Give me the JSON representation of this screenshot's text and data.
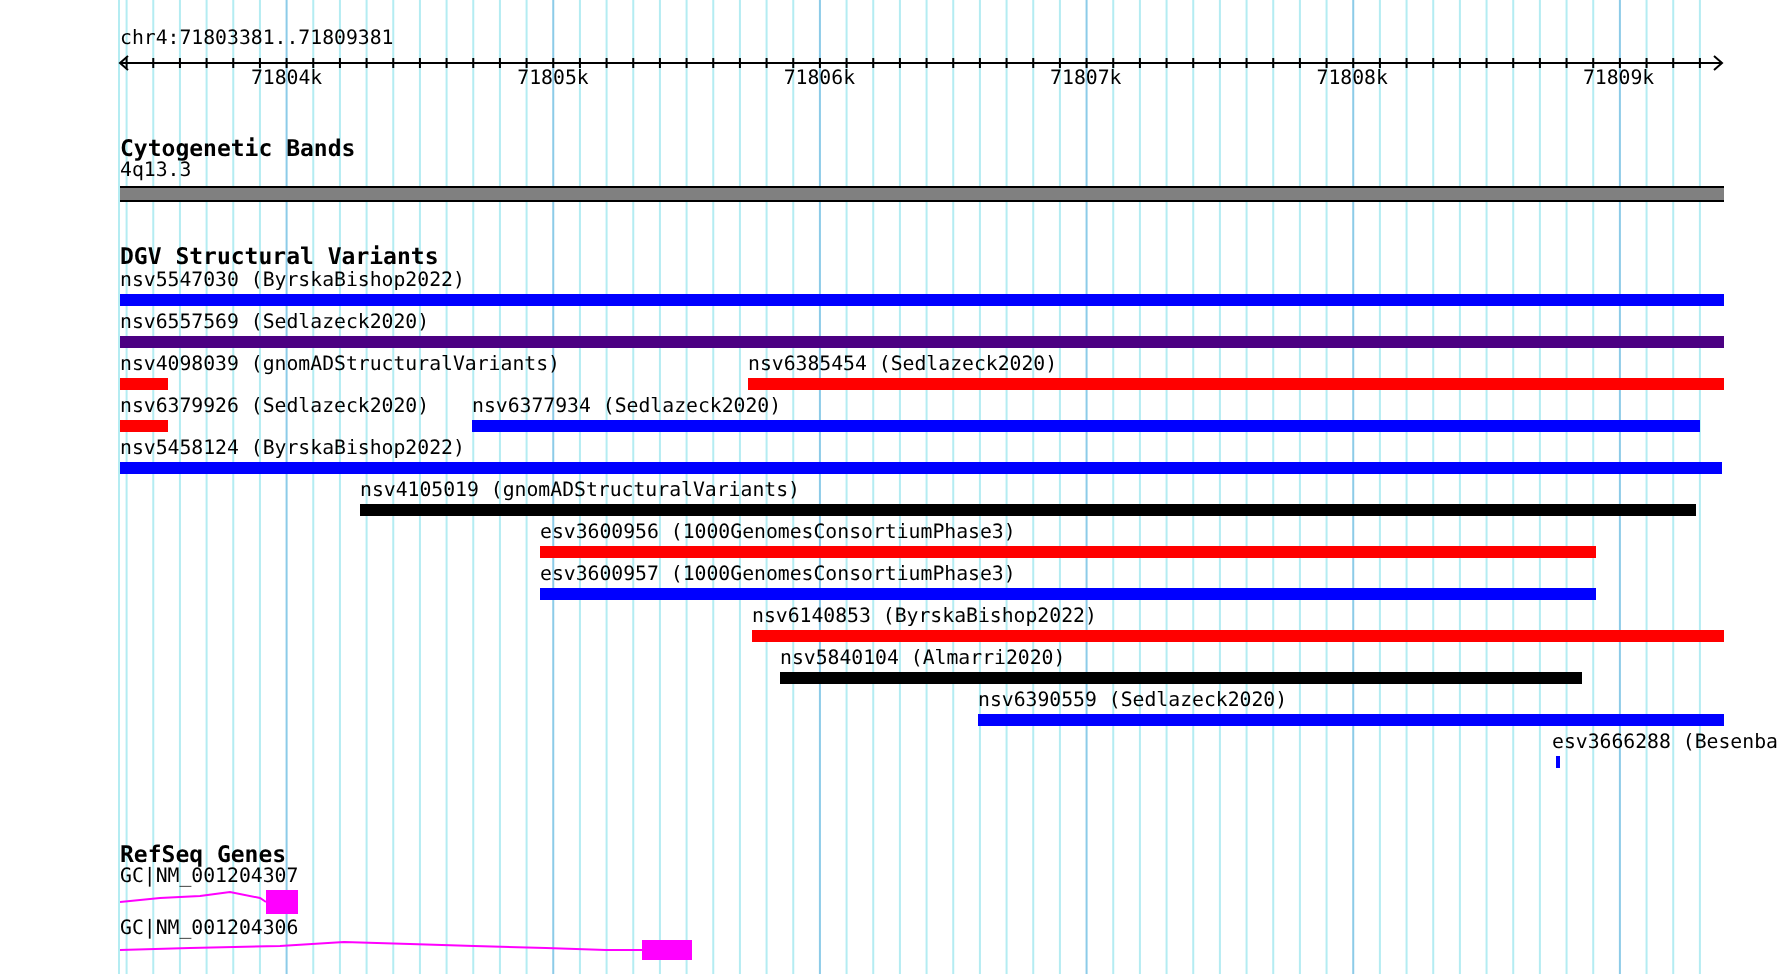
{
  "location": "chr4:71803381..71809381",
  "ruler": {
    "ticks": [
      "71804k",
      "71805k",
      "71806k",
      "71807k",
      "71808k",
      "71809k"
    ]
  },
  "tracks": [
    {
      "kind": "bands",
      "title": "Cytogenetic Bands",
      "features": [
        {
          "label": "4q13.3"
        }
      ]
    },
    {
      "kind": "variants",
      "title": "DGV Structural Variants",
      "rows": [
        [
          {
            "label": "nsv5547030 (ByrskaBishop2022)",
            "color": "#0000ff"
          }
        ],
        [
          {
            "label": "nsv6557569 (Sedlazeck2020)",
            "color": "#4b0082"
          }
        ],
        [
          {
            "label": "nsv4098039 (gnomADStructuralVariants)",
            "color": "#ff0000"
          },
          {
            "label": "nsv6385454 (Sedlazeck2020)",
            "color": "#ff0000"
          }
        ],
        [
          {
            "label": "nsv6379926 (Sedlazeck2020)",
            "color": "#ff0000"
          },
          {
            "label": "nsv6377934 (Sedlazeck2020)",
            "color": "#0000ff"
          }
        ],
        [
          {
            "label": "nsv5458124 (ByrskaBishop2022)",
            "color": "#0000ff"
          }
        ],
        [
          {
            "label": "nsv4105019 (gnomADStructuralVariants)",
            "color": "#000000"
          }
        ],
        [
          {
            "label": "esv3600956 (1000GenomesConsortiumPhase3)",
            "color": "#ff0000"
          }
        ],
        [
          {
            "label": "esv3600957 (1000GenomesConsortiumPhase3)",
            "color": "#0000ff"
          }
        ],
        [
          {
            "label": "nsv6140853 (ByrskaBishop2022)",
            "color": "#ff0000"
          }
        ],
        [
          {
            "label": "nsv5840104 (Almarri2020)",
            "color": "#000000"
          }
        ],
        [
          {
            "label": "nsv6390559 (Sedlazeck2020)",
            "color": "#0000ff"
          }
        ],
        [
          {
            "label": "esv3666288 (Besenba",
            "color": "#0000ff"
          }
        ]
      ]
    },
    {
      "kind": "genes",
      "title": "RefSeq Genes",
      "features": [
        {
          "label": "GC|NM_001204307"
        },
        {
          "label": "GC|NM_001204306"
        }
      ]
    }
  ]
}
